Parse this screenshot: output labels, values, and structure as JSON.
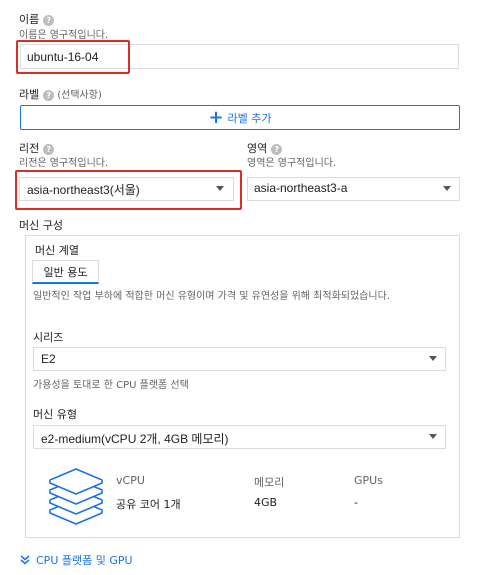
{
  "name": {
    "label": "이름",
    "help": "?",
    "sub": "이름은 영구적입니다.",
    "value": "ubuntu-16-04"
  },
  "labels": {
    "label": "라벨",
    "optional": "(선택사항)",
    "add_button": "라벨 추가",
    "plus": "+"
  },
  "region": {
    "label": "리전",
    "help": "?",
    "sub": "리전은 영구적입니다.",
    "value": "asia-northeast3(서울)"
  },
  "zone": {
    "label": "영역",
    "help": "?",
    "sub": "영역은 영구적입니다.",
    "value": "asia-northeast3-a"
  },
  "machine_config": {
    "title": "머신 구성",
    "family_label": "머신 계열",
    "family_tab": "일반 용도",
    "family_desc": "일반적인 작업 부하에 적합한 머신 유형이며 가격 및 유연성을 위해 최적화되었습니다.",
    "series_label": "시리즈",
    "series_value": "E2",
    "series_desc": "가용성을 토대로 한 CPU 플랫폼 선택",
    "type_label": "머신 유형",
    "type_value": "e2-medium(vCPU 2개, 4GB 메모리)",
    "table": {
      "headers": [
        "vCPU",
        "메모리",
        "GPUs"
      ],
      "values": [
        "공유 코어 1개",
        "4GB",
        "-"
      ]
    }
  },
  "cpu_platform_link": "CPU 플랫폼 및 GPU",
  "colors": {
    "accent": "#1a73e8",
    "red": "#d93025"
  }
}
